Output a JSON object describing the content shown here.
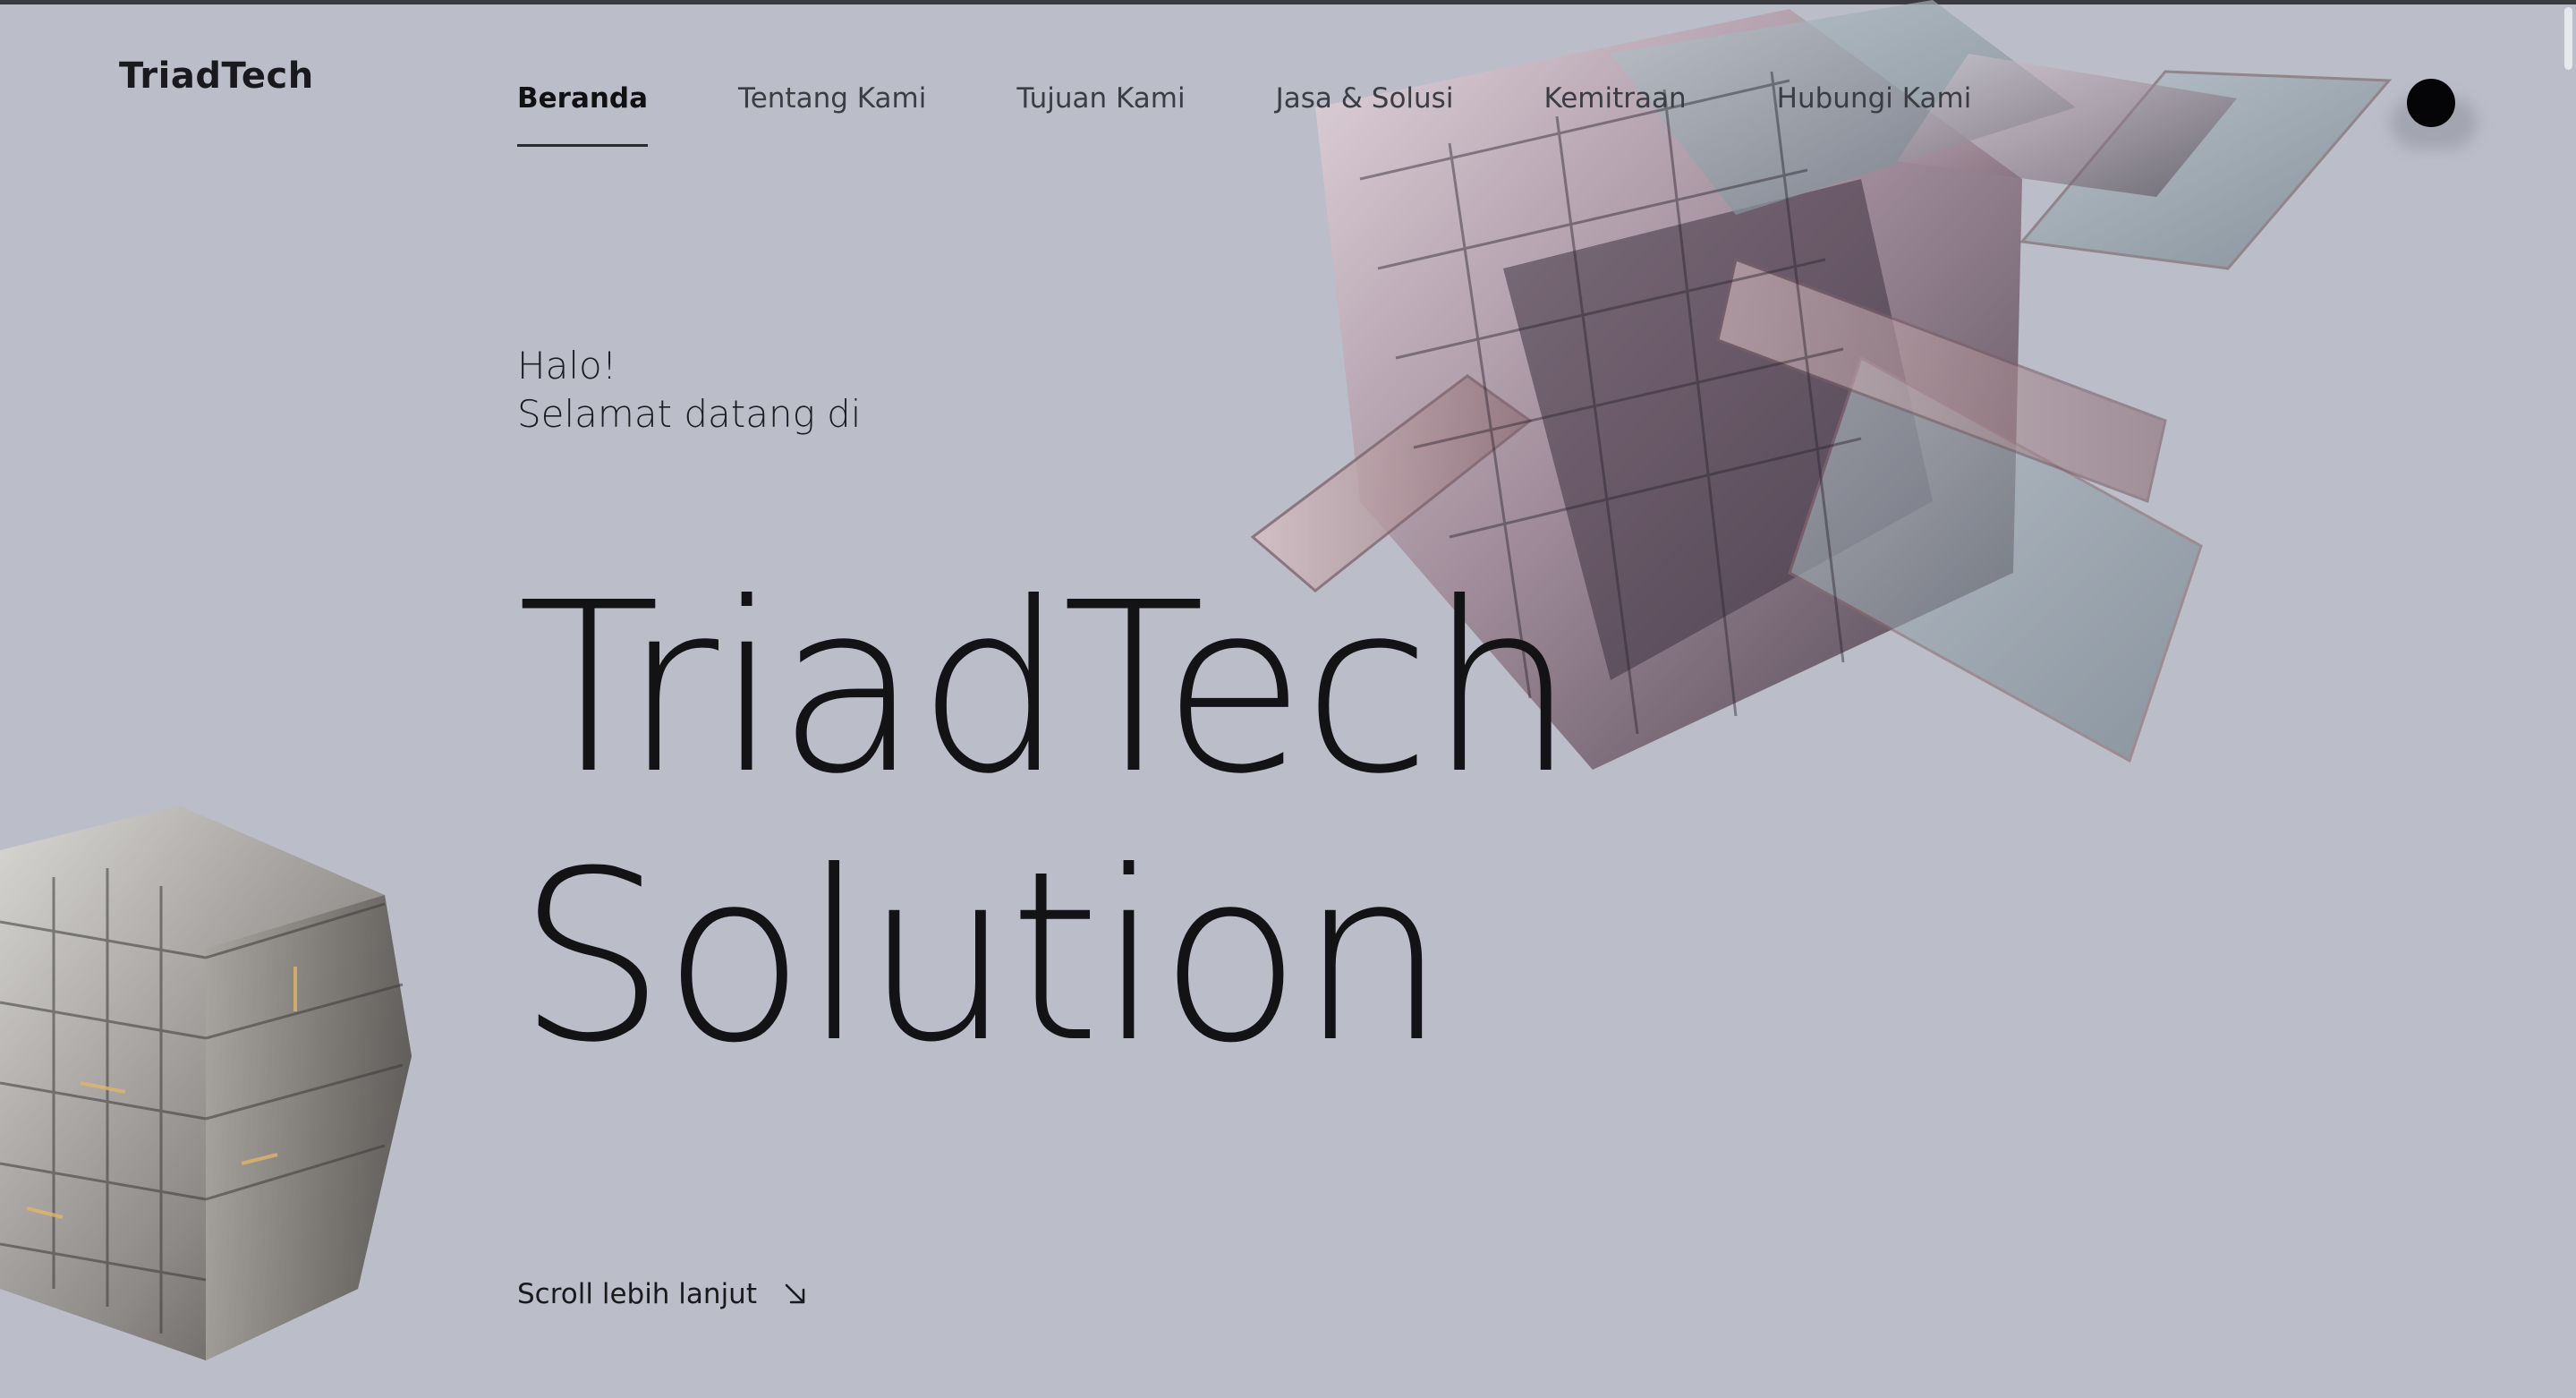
{
  "brand": {
    "logo_text": "TriadTech"
  },
  "nav": {
    "items": [
      {
        "label": "Beranda",
        "active": true
      },
      {
        "label": "Tentang Kami",
        "active": false
      },
      {
        "label": "Tujuan Kami",
        "active": false
      },
      {
        "label": "Jasa & Solusi",
        "active": false
      },
      {
        "label": "Kemitraan",
        "active": false
      },
      {
        "label": "Hubungi Kami",
        "active": false
      }
    ]
  },
  "hero": {
    "greeting_line1": "Halo!",
    "greeting_line2": "Selamat datang di",
    "title_line1": "TriadTech",
    "title_line2": "Solution"
  },
  "scroll_cta": {
    "label": "Scroll lebih lanjut",
    "icon": "arrow-down-right-icon"
  },
  "theme_toggle": {
    "icon": "dark-mode-dot-icon"
  },
  "colors": {
    "background": "#bbbdc8",
    "text": "#131316",
    "accent": "#050507"
  }
}
